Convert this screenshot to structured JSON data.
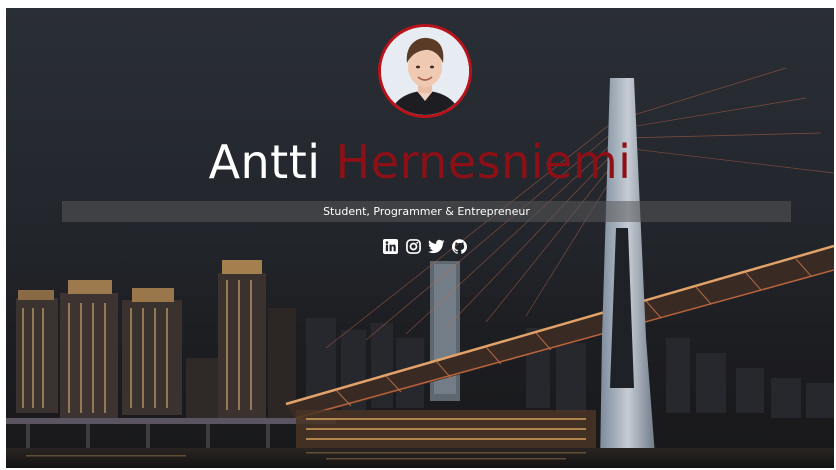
{
  "hero": {
    "first_name": "Antti",
    "last_name": "Hernesniemi",
    "tagline": "Student, Programmer & Entrepreneur"
  },
  "colors": {
    "accent": "#8c1016",
    "avatar_border": "#b8121b",
    "text": "#ffffff",
    "tagline_bar": "#585858"
  },
  "social_links": [
    {
      "icon": "linkedin-icon"
    },
    {
      "icon": "instagram-icon"
    },
    {
      "icon": "twitter-icon"
    },
    {
      "icon": "github-icon"
    }
  ]
}
